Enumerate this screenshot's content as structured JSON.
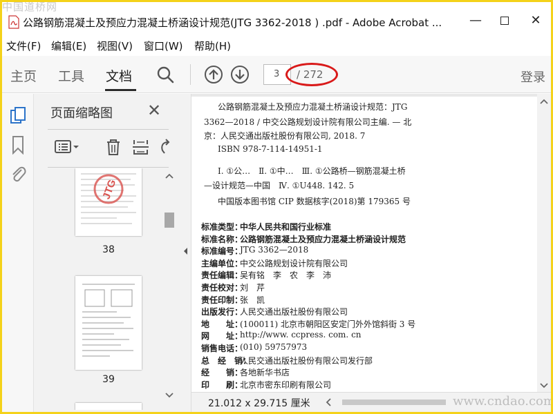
{
  "watermark_top": "中国道桥网",
  "watermark_bottom": "www.cndao.com",
  "window": {
    "title": "公路钢筋混凝土及预应力混凝土桥涵设计规范(JTG 3362-2018 ) .pdf - Adobe Acrobat ...",
    "min_label": "—",
    "close_label": "✕"
  },
  "menu": [
    "文件(F)",
    "编辑(E)",
    "视图(V)",
    "窗口(W)",
    "帮助(H)"
  ],
  "toolbar": {
    "tabs": [
      "主页",
      "工具",
      "文档"
    ],
    "active_tab": "文档",
    "page_current": "3",
    "page_total": "/ 272",
    "login": "登录"
  },
  "panel": {
    "title": "页面缩略图",
    "close": "✕",
    "thumbnails": [
      {
        "label": "38",
        "stamp": "JTG"
      },
      {
        "label": "39"
      }
    ]
  },
  "document": {
    "cip_lines": [
      "公路钢筋混凝土及预应力混凝土桥涵设计规范：JTG",
      "3362—2018 / 中交公路规划设计院有限公司主编. — 北",
      "京：人民交通出版社股份有限公司, 2018. 7",
      "ISBN  978-7-114-14951-1",
      "Ⅰ. ①公…　Ⅱ. ①中…　Ⅲ. ①公路桥—钢筋混凝土桥",
      "—设计规范—中国　Ⅳ. ①U448. 142. 5",
      "中国版本图书馆 CIP 数据核字(2018)第 179365 号"
    ],
    "info_rows": [
      {
        "k": "标准类型：",
        "v": "中华人民共和国行业标准",
        "bold": true
      },
      {
        "k": "标准名称：",
        "v": "公路钢筋混凝土及预应力混凝土桥涵设计规范",
        "bold": true
      },
      {
        "k": "标准编号：",
        "v": "JTG  3362—2018"
      },
      {
        "k": "主编单位：",
        "v": "中交公路规划设计院有限公司"
      },
      {
        "k": "责任编辑：",
        "v": "吴有铭　李　农　李　沛"
      },
      {
        "k": "责任校对：",
        "v": "刘　芹"
      },
      {
        "k": "责任印制：",
        "v": "张　凯"
      },
      {
        "k": "出版发行：",
        "v": "人民交通出版社股份有限公司"
      },
      {
        "k": "地　　址：",
        "v": "(100011) 北京市朝阳区安定门外外馆斜街 3 号"
      },
      {
        "k": "网　　址：",
        "v": "http://www. ccpress. com. cn"
      },
      {
        "k": "销售电话：",
        "v": "(010) 59757973"
      },
      {
        "k": "总　经　销：",
        "v": "人民交通出版社股份有限公司发行部"
      },
      {
        "k": "经　　销：",
        "v": "各地新华书店"
      },
      {
        "k": "印　　刷：",
        "v": "北京市密东印刷有限公司"
      }
    ]
  },
  "status": {
    "page_size": "21.012 x 29.715 厘米"
  },
  "colors": {
    "accent_blue": "#2b73c9",
    "annotation_red": "#d91a1a",
    "stamp_red": "#d9534f",
    "frame_yellow": "#f4d21a"
  }
}
